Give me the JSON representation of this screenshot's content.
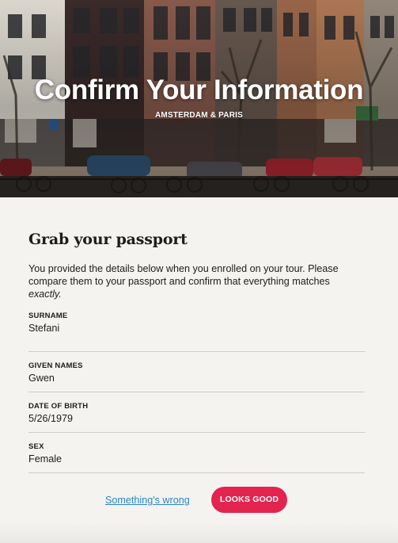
{
  "hero": {
    "title": "Confirm Your Information",
    "subtitle": "AMSTERDAM & PARIS"
  },
  "content": {
    "heading": "Grab your passport",
    "intro_text": "You provided the details below when you enrolled on your tour. Please compare them to your passport and confirm that everything matches",
    "intro_emphasis": "exactly."
  },
  "fields": [
    {
      "label": "SURNAME",
      "value": "Stefani"
    },
    {
      "label": "GIVEN NAMES",
      "value": "Gwen"
    },
    {
      "label": "DATE OF BIRTH",
      "value": "5/26/1979"
    },
    {
      "label": "SEX",
      "value": "Female"
    }
  ],
  "actions": {
    "wrong_link": "Something's wrong",
    "confirm_button": "LOOKS GOOD"
  },
  "colors": {
    "accent": "#e3244f",
    "link": "#2a86c8",
    "background": "#f4f3ef"
  }
}
